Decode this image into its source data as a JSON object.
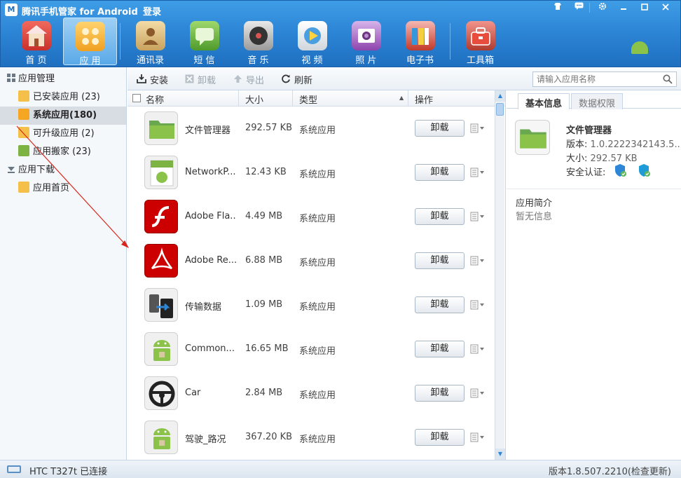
{
  "window": {
    "title": "腾讯手机管家 for Android",
    "login": "登录",
    "buttons": [
      "shirt-icon",
      "chat-icon",
      "gear-icon",
      "minimize-icon",
      "maximize-icon",
      "close-icon"
    ]
  },
  "nav": [
    {
      "label": "首 页",
      "icon": "home-icon",
      "color": "#d9534f",
      "active": false
    },
    {
      "label": "应 用",
      "icon": "apps-icon",
      "color": "#f5a623",
      "active": true
    },
    {
      "label": "通讯录",
      "icon": "contacts-icon",
      "color": "#d9b26b",
      "active": false
    },
    {
      "label": "短 信",
      "icon": "sms-icon",
      "color": "#6ab04c",
      "active": false
    },
    {
      "label": "音 乐",
      "icon": "music-icon",
      "color": "#555555",
      "active": false
    },
    {
      "label": "视 频",
      "icon": "video-icon",
      "color": "#e8e8e8",
      "active": false
    },
    {
      "label": "照 片",
      "icon": "photo-icon",
      "color": "#9b59b6",
      "active": false
    },
    {
      "label": "电子书",
      "icon": "ebook-icon",
      "color": "#e74c3c",
      "active": false
    },
    {
      "label": "工具箱",
      "icon": "toolbox-icon",
      "color": "#c0392b",
      "active": false
    }
  ],
  "sidebar": {
    "group1": "应用管理",
    "items1": [
      {
        "label": "已安装应用 (23)",
        "icon": "installed-icon",
        "active": false
      },
      {
        "label": "系统应用(180)",
        "icon": "system-app-icon",
        "active": true
      },
      {
        "label": "可升级应用 (2)",
        "icon": "upgrade-icon",
        "active": false
      },
      {
        "label": "应用搬家 (23)",
        "icon": "move-app-icon",
        "active": false
      }
    ],
    "group2": "应用下载",
    "items2": [
      {
        "label": "应用首页",
        "icon": "app-home-icon",
        "active": false
      }
    ]
  },
  "toolbar": {
    "install": "安装",
    "uninstall": "卸载",
    "export": "导出",
    "refresh": "刷新",
    "search_placeholder": "请输入应用名称"
  },
  "list": {
    "headers": {
      "name": "名称",
      "size": "大小",
      "type": "类型",
      "action": "操作"
    },
    "uninstall_label": "卸载",
    "rows": [
      {
        "name": "文件管理器",
        "size": "292.57 KB",
        "type": "系统应用",
        "icon": "folder-icon"
      },
      {
        "name": "NetworkP...",
        "size": "12.43 KB",
        "type": "系统应用",
        "icon": "android-app-icon"
      },
      {
        "name": "Adobe Fla...",
        "size": "4.49 MB",
        "type": "系统应用",
        "icon": "flash-icon"
      },
      {
        "name": "Adobe Re...",
        "size": "6.88 MB",
        "type": "系统应用",
        "icon": "pdf-icon"
      },
      {
        "name": "传输数据",
        "size": "1.09 MB",
        "type": "系统应用",
        "icon": "transfer-icon"
      },
      {
        "name": "Common...",
        "size": "16.65 MB",
        "type": "系统应用",
        "icon": "android-robot-icon"
      },
      {
        "name": "Car",
        "size": "2.84 MB",
        "type": "系统应用",
        "icon": "steering-wheel-icon"
      },
      {
        "name": "驾驶_路况",
        "size": "367.20 KB",
        "type": "系统应用",
        "icon": "android-robot-icon"
      }
    ]
  },
  "detail": {
    "tab_basic": "基本信息",
    "tab_perm": "数据权限",
    "name": "文件管理器",
    "version_label": "版本:",
    "version_value": "1.0.2222342143.5...",
    "size_label": "大小:",
    "size_value": "292.57 KB",
    "security_label": "安全认证:",
    "intro_title": "应用简介",
    "intro_text": "暂无信息"
  },
  "status": {
    "device": "HTC T327t  已连接",
    "version": "版本1.8.507.2210(检查更新)"
  },
  "colors": {
    "accent": "#2d86d6",
    "folder": "#6aa84f",
    "flash": "#cc0000",
    "android": "#8bc34a"
  }
}
